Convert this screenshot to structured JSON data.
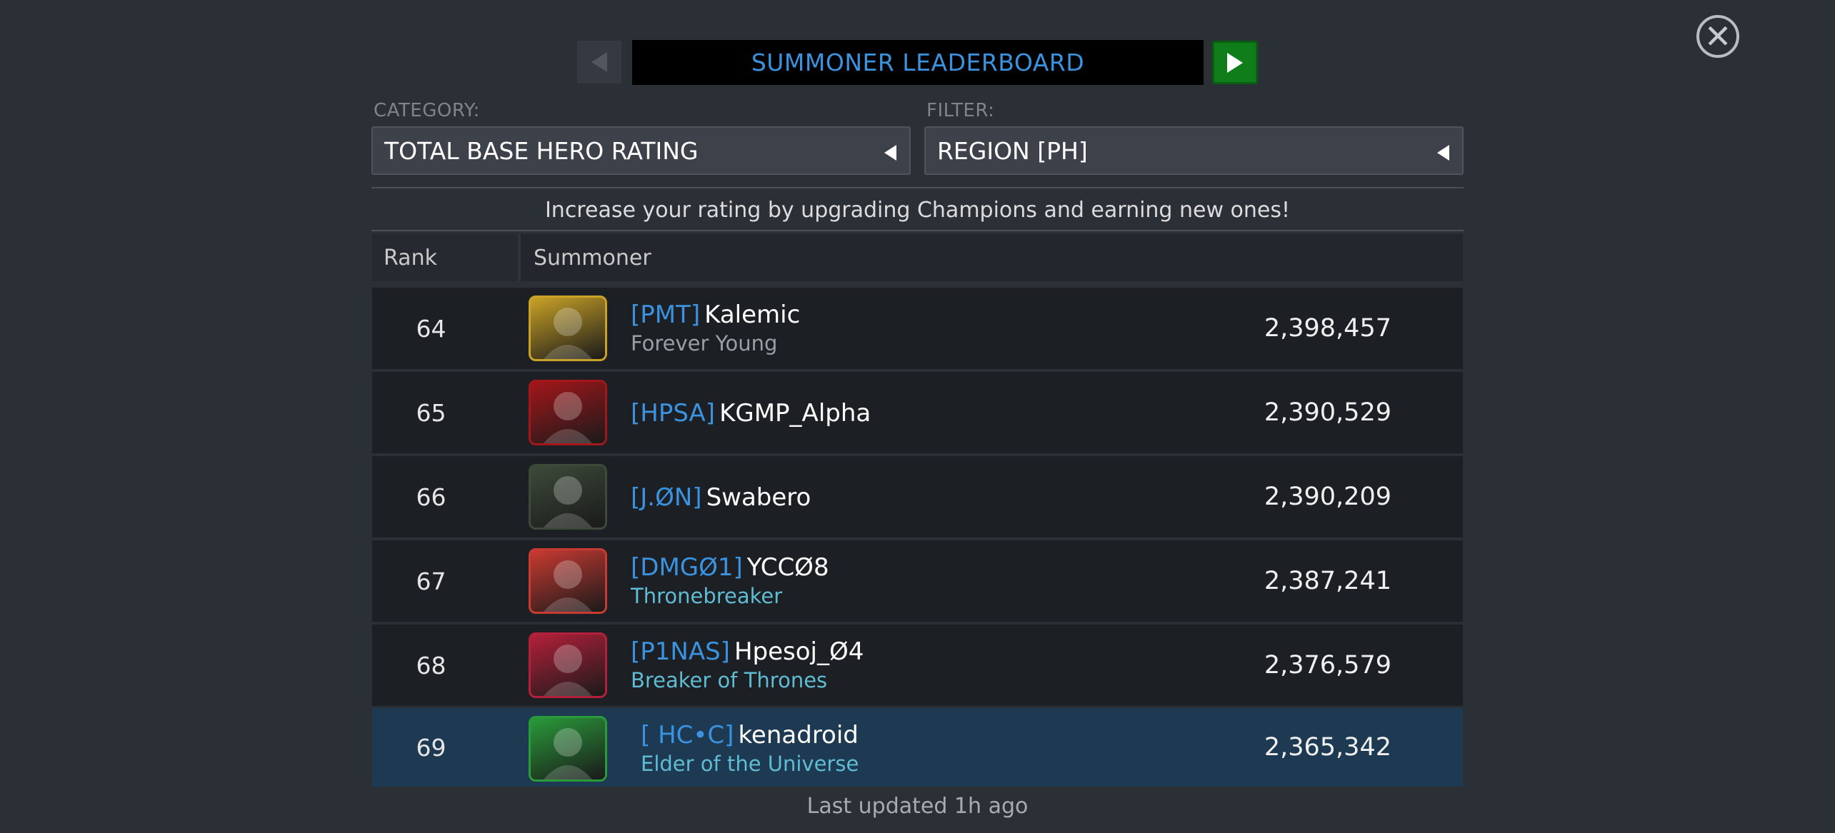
{
  "header": {
    "title": "SUMMONER LEADERBOARD",
    "close_icon": "close-icon",
    "prev_icon": "arrow-left-icon",
    "next_icon": "arrow-right-icon"
  },
  "category": {
    "label": "CATEGORY:",
    "value": "TOTAL BASE HERO RATING"
  },
  "filter": {
    "label": "FILTER:",
    "value": "REGION [PH]"
  },
  "info": "Increase your rating by upgrading Champions and earning new ones!",
  "table": {
    "headers": {
      "rank": "Rank",
      "summoner": "Summoner"
    },
    "rows": [
      {
        "rank": "64",
        "tag": "[PMT]",
        "name": "Kalemic",
        "title": "Forever Young",
        "title_color": "#9a9ea5",
        "rating": "2,398,457",
        "avatar_color": "#c9a227"
      },
      {
        "rank": "65",
        "tag": "[HPSA]",
        "name": "KGMP_Alpha",
        "title": "",
        "title_color": "#9a9ea5",
        "rating": "2,390,529",
        "avatar_color": "#a3161a"
      },
      {
        "rank": "66",
        "tag": "[J.ØN]",
        "name": "Swabero",
        "title": "",
        "title_color": "#9a9ea5",
        "rating": "2,390,209",
        "avatar_color": "#3d4a3a"
      },
      {
        "rank": "67",
        "tag": "[DMGØ1]",
        "name": "YCCØ8",
        "title": "Thronebreaker",
        "title_color": "#5fbcd3",
        "rating": "2,387,241",
        "avatar_color": "#c93a32"
      },
      {
        "rank": "68",
        "tag": "[P1NAS]",
        "name": "Hpesoj_Ø4",
        "title": "Breaker of Thrones",
        "title_color": "#5fbcd3",
        "rating": "2,376,579",
        "avatar_color": "#b3203a"
      },
      {
        "rank": "69",
        "tag": "[ HC•C]",
        "name": "kenadroid",
        "title": "Elder of the Universe",
        "title_color": "#5fbcd3",
        "rating": "2,365,342",
        "avatar_color": "#2a9a3a",
        "highlight": true
      }
    ]
  },
  "footer": "Last updated 1h ago"
}
